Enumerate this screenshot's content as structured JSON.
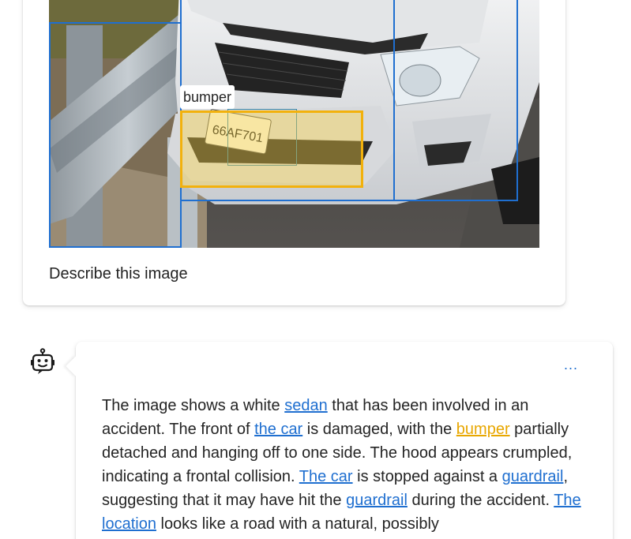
{
  "user_message": {
    "prompt": "Describe this image",
    "image": {
      "detections": [
        {
          "label": "bumper",
          "active": true
        },
        {
          "label": "",
          "active": false
        },
        {
          "label": "",
          "active": false
        },
        {
          "label": "",
          "active": false
        },
        {
          "label": "",
          "active": false
        },
        {
          "label": "",
          "active": false
        }
      ]
    }
  },
  "bot_message": {
    "more_label": "...",
    "segments": [
      {
        "text": "The image shows a white ",
        "link": false
      },
      {
        "text": "sedan",
        "link": true,
        "highlight": false
      },
      {
        "text": " that has been involved in an accident. The front of ",
        "link": false
      },
      {
        "text": "the car",
        "link": true,
        "highlight": false
      },
      {
        "text": " is damaged, with the ",
        "link": false
      },
      {
        "text": "bumper",
        "link": true,
        "highlight": true
      },
      {
        "text": " partially detached and hanging off to one side. The hood appears crumpled, indicating a frontal collision. ",
        "link": false
      },
      {
        "text": "The car",
        "link": true,
        "highlight": false
      },
      {
        "text": " is stopped against a ",
        "link": false
      },
      {
        "text": "guardrail",
        "link": true,
        "highlight": false
      },
      {
        "text": ", suggesting that it may have hit the ",
        "link": false
      },
      {
        "text": "guardrail",
        "link": true,
        "highlight": false
      },
      {
        "text": " during the accident. ",
        "link": false
      },
      {
        "text": "The location",
        "link": true,
        "highlight": false
      },
      {
        "text": " looks like a road with a natural, possibly",
        "link": false
      }
    ]
  },
  "colors": {
    "link": "#1f6fd0",
    "highlight": "#f2b10c",
    "box": "#1f6fd0"
  },
  "icons": {
    "bot_avatar": "bot-icon",
    "more": "more-horizontal-icon"
  }
}
